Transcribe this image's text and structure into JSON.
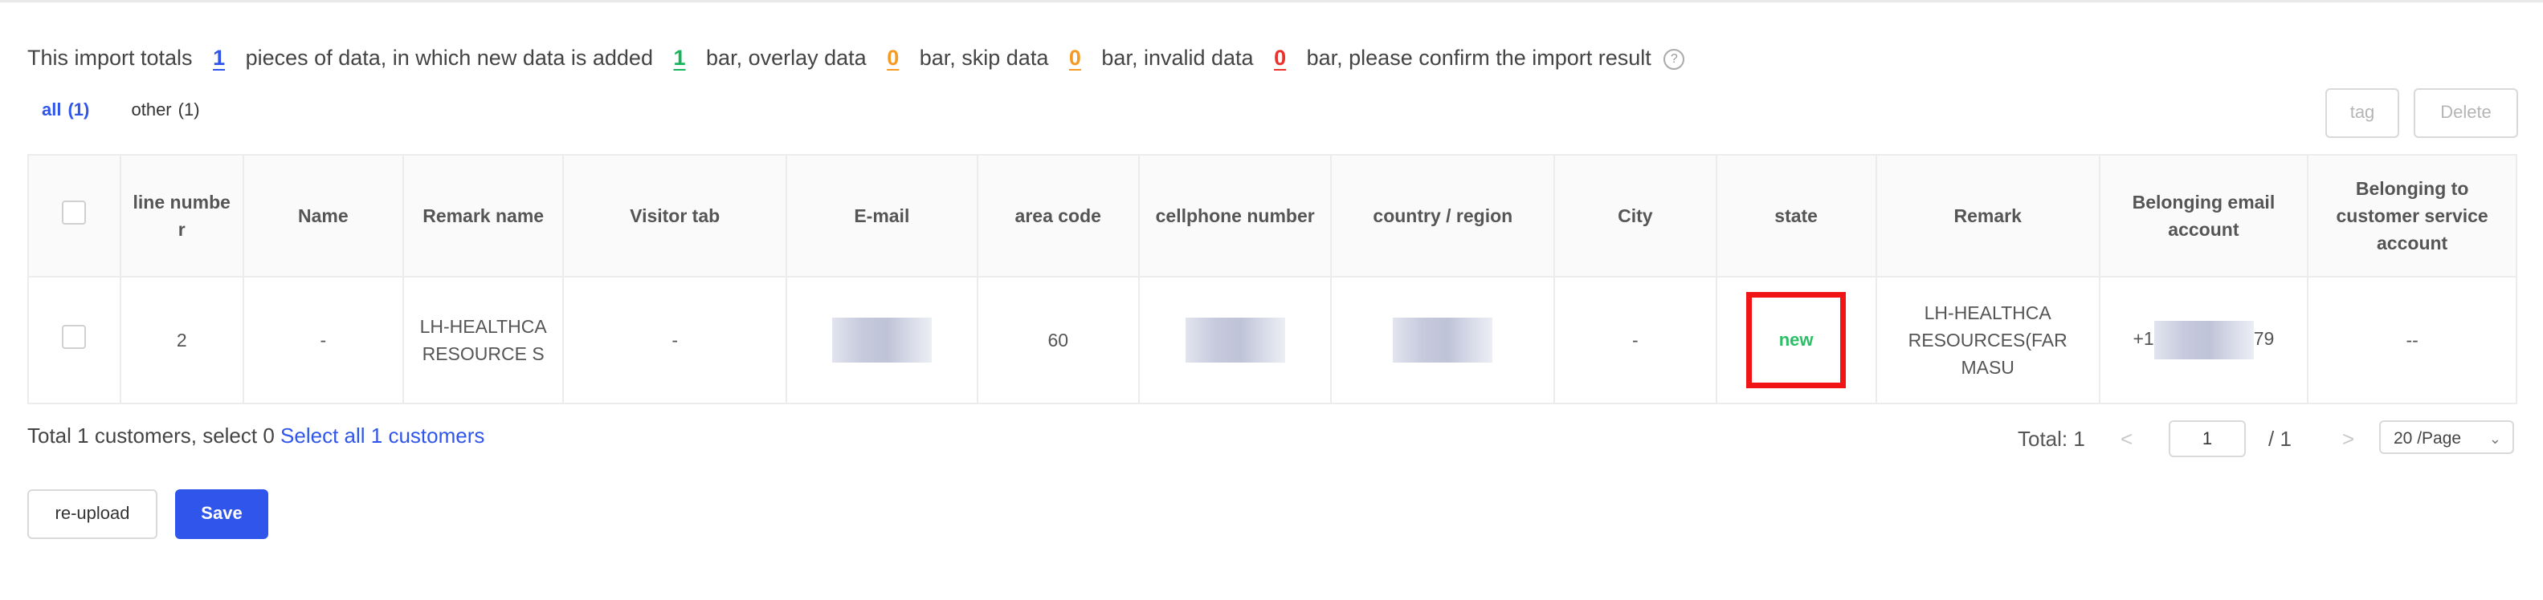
{
  "summary": {
    "p1": "This import totals",
    "total": "1",
    "p2": "pieces of data, in which new data is added",
    "added": "1",
    "p3": "bar, overlay data",
    "overlay": "0",
    "p4": "bar, skip data",
    "skip": "0",
    "p5": "bar, invalid data",
    "invalid": "0",
    "p6": "bar, please confirm the import result",
    "help_icon": "question-circle-icon"
  },
  "tabs": [
    {
      "label": "all",
      "count": "(1)"
    },
    {
      "label": "other",
      "count": "(1)"
    }
  ],
  "toolbar": {
    "tag_label": "tag",
    "delete_label": "Delete"
  },
  "table": {
    "headers": [
      "line numbe r",
      "Name",
      "Remark name",
      "Visitor tab",
      "E-mail",
      "area code",
      "cellphone number",
      "country / region",
      "City",
      "state",
      "Remark",
      "Belonging email account",
      "Belonging to customer service account"
    ],
    "row": {
      "line": "2",
      "name": "-",
      "remark_name": "LH-HEALTHCA RESOURCE S",
      "visitor_tab": "-",
      "area_code": "60",
      "city": "-",
      "state": "new",
      "remark": "LH-HEALTHCA RESOURCES(FAR MASU",
      "email_account_prefix": "+1",
      "email_account_suffix": "79",
      "cs_account": "--"
    }
  },
  "footer": {
    "text": "Total 1 customers, select 0",
    "link": "Select all 1 customers"
  },
  "pagination": {
    "total": "Total:  1",
    "prev": "<",
    "page": "1",
    "of": "/ 1",
    "next": ">",
    "size": "20 /Page"
  },
  "actions": {
    "reupload_label": "re-upload",
    "save_label": "Save"
  },
  "colors": {
    "accent": "#2f55eb",
    "new_state": "#2bbf65",
    "highlight_border": "#f01414",
    "overlay": "#f59a23",
    "invalid": "#e8322b"
  }
}
